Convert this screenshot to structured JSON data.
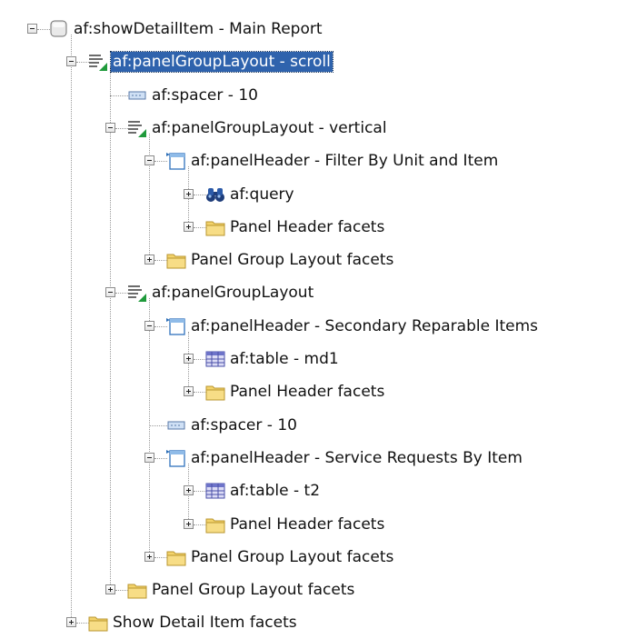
{
  "tree": {
    "nodes": [
      {
        "label": "af:showDetailItem - Main Report",
        "icon": "detail-item-icon",
        "toggle": "minus",
        "depth": 0
      },
      {
        "label": "af:panelGroupLayout - scroll",
        "icon": "panel-group-layout-icon",
        "toggle": "minus",
        "depth": 1,
        "selected": true
      },
      {
        "label": "af:spacer - 10",
        "icon": "spacer-icon",
        "toggle": "none",
        "depth": 2
      },
      {
        "label": "af:panelGroupLayout - vertical",
        "icon": "panel-group-layout-icon",
        "toggle": "minus",
        "depth": 2
      },
      {
        "label": "af:panelHeader - Filter By Unit and Item",
        "icon": "panel-header-icon",
        "toggle": "minus",
        "depth": 3
      },
      {
        "label": "af:query",
        "icon": "binoculars-icon",
        "toggle": "plus",
        "depth": 4
      },
      {
        "label": "Panel Header facets",
        "icon": "folder-icon",
        "toggle": "plus",
        "depth": 4
      },
      {
        "label": "Panel Group Layout facets",
        "icon": "folder-icon",
        "toggle": "plus",
        "depth": 3
      },
      {
        "label": "af:panelGroupLayout",
        "icon": "panel-group-layout-icon",
        "toggle": "minus",
        "depth": 2
      },
      {
        "label": "af:panelHeader - Secondary Reparable Items",
        "icon": "panel-header-icon",
        "toggle": "minus",
        "depth": 3
      },
      {
        "label": "af:table - md1",
        "icon": "table-icon",
        "toggle": "plus",
        "depth": 4
      },
      {
        "label": "Panel Header facets",
        "icon": "folder-icon",
        "toggle": "plus",
        "depth": 4
      },
      {
        "label": "af:spacer - 10",
        "icon": "spacer-icon",
        "toggle": "none",
        "depth": 3
      },
      {
        "label": "af:panelHeader - Service Requests By Item",
        "icon": "panel-header-icon",
        "toggle": "minus",
        "depth": 3
      },
      {
        "label": "af:table - t2",
        "icon": "table-icon",
        "toggle": "plus",
        "depth": 4
      },
      {
        "label": "Panel Header facets",
        "icon": "folder-icon",
        "toggle": "plus",
        "depth": 4
      },
      {
        "label": "Panel Group Layout facets",
        "icon": "folder-icon",
        "toggle": "plus",
        "depth": 3
      },
      {
        "label": "Panel Group Layout facets",
        "icon": "folder-icon",
        "toggle": "plus",
        "depth": 2
      },
      {
        "label": "Show Detail Item facets",
        "icon": "folder-icon",
        "toggle": "plus",
        "depth": 1
      }
    ]
  },
  "colors": {
    "selection": "#2f63ad",
    "folder": "#f3d36b",
    "table": "#6d73c9",
    "badge": "#1f9a3b"
  }
}
